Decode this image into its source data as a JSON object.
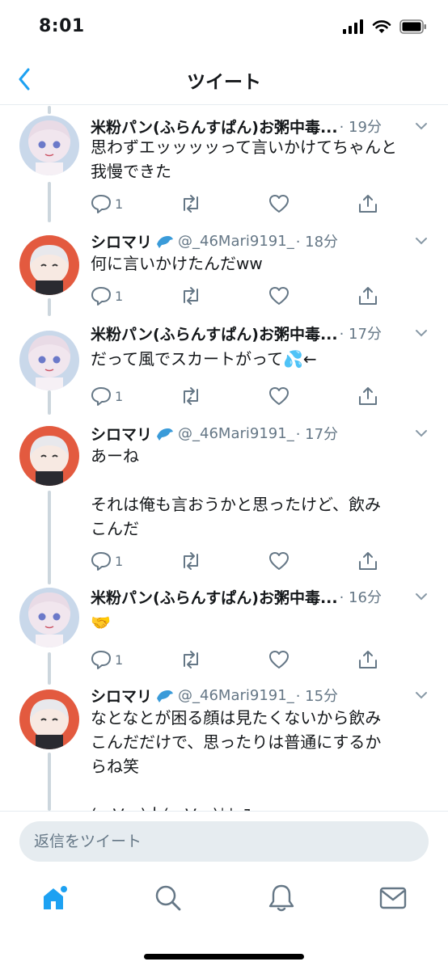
{
  "status_bar": {
    "time": "8:01"
  },
  "header": {
    "title": "ツイート",
    "back_icon": "chevron-left-icon"
  },
  "colors": {
    "accent": "#1da1f2",
    "secondary_text": "#657786",
    "thread_line": "#ccd6dd",
    "avatar_a_bg": "#c9d8ea",
    "avatar_b_bg": "#e35a3f"
  },
  "tweets": [
    {
      "name": "米粉パン(ふらんすぱん)お粥中毒...",
      "handle": "",
      "time": "· 19分",
      "text": "思わずエッッッッって言いかけてちゃんと\n我慢できた",
      "reply_count": "1"
    },
    {
      "name": "シロマリ",
      "handle": "@_46Mari9191_",
      "time": "· 18分",
      "text": "何に言いかけたんだww",
      "reply_count": "1"
    },
    {
      "name": "米粉パン(ふらんすぱん)お粥中毒...",
      "handle": "",
      "time": "· 17分",
      "text": "だって風でスカートがって💦←",
      "reply_count": "1"
    },
    {
      "name": "シロマリ",
      "handle": "@_46Mari9191_",
      "time": "· 17分",
      "text": "あーね\n\nそれは俺も言おうかと思ったけど、飲み\nこんだ",
      "reply_count": "1"
    },
    {
      "name": "米粉パン(ふらんすぱん)お粥中毒...",
      "handle": "",
      "time": "· 16分",
      "text": "🤝",
      "reply_count": "1"
    },
    {
      "name": "シロマリ",
      "handle": "@_46Mari9191_",
      "time": "· 15分",
      "text": "なとなとが困る顔は見たくないから飲み\nこんだだけで、思ったりは普通にするか\nらね笑\n\n(・∀・)人(・∀・)ｶﾅｰｽ",
      "reply_count": ""
    }
  ],
  "reply_bar": {
    "placeholder": "返信をツイート"
  },
  "bottom_nav": {
    "items": [
      "home-icon",
      "search-icon",
      "notifications-icon",
      "messages-icon"
    ]
  }
}
